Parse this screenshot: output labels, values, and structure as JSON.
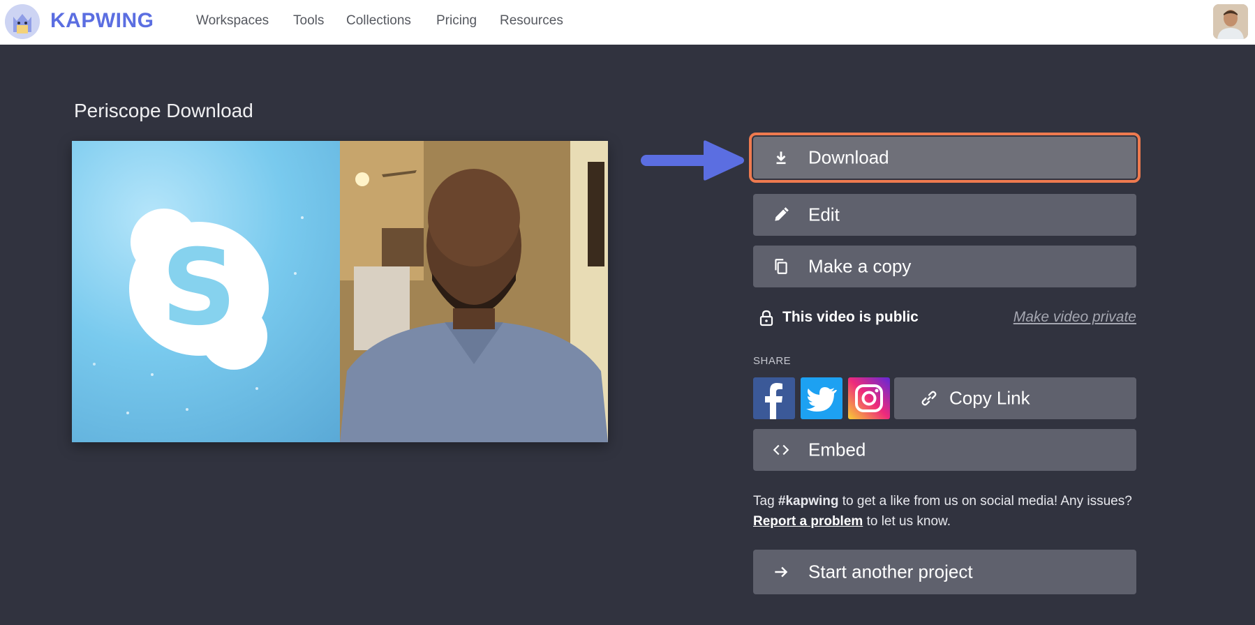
{
  "brand": {
    "name": "KAPWING",
    "accent": "#5b6ee1"
  },
  "nav": {
    "items": [
      {
        "label": "Workspaces"
      },
      {
        "label": "Tools"
      },
      {
        "label": "Collections"
      },
      {
        "label": "Pricing"
      },
      {
        "label": "Resources"
      }
    ]
  },
  "page": {
    "title": "Periscope Download"
  },
  "actions": {
    "download": "Download",
    "edit": "Edit",
    "copy": "Make a copy",
    "embed": "Embed",
    "start": "Start another project"
  },
  "privacy": {
    "status": "This video is public",
    "toggle": "Make video private"
  },
  "share": {
    "label": "SHARE",
    "copy_link": "Copy Link"
  },
  "tag": {
    "prefix": "Tag ",
    "hashtag": "#kapwing",
    "middle": " to get a like from us on social media! Any issues? ",
    "report_link": "Report a problem",
    "suffix": " to let us know."
  },
  "colors": {
    "background": "#31333f",
    "button": "#5f616d",
    "highlight_outline": "#ee7a4f",
    "arrow": "#5b6ee1"
  }
}
